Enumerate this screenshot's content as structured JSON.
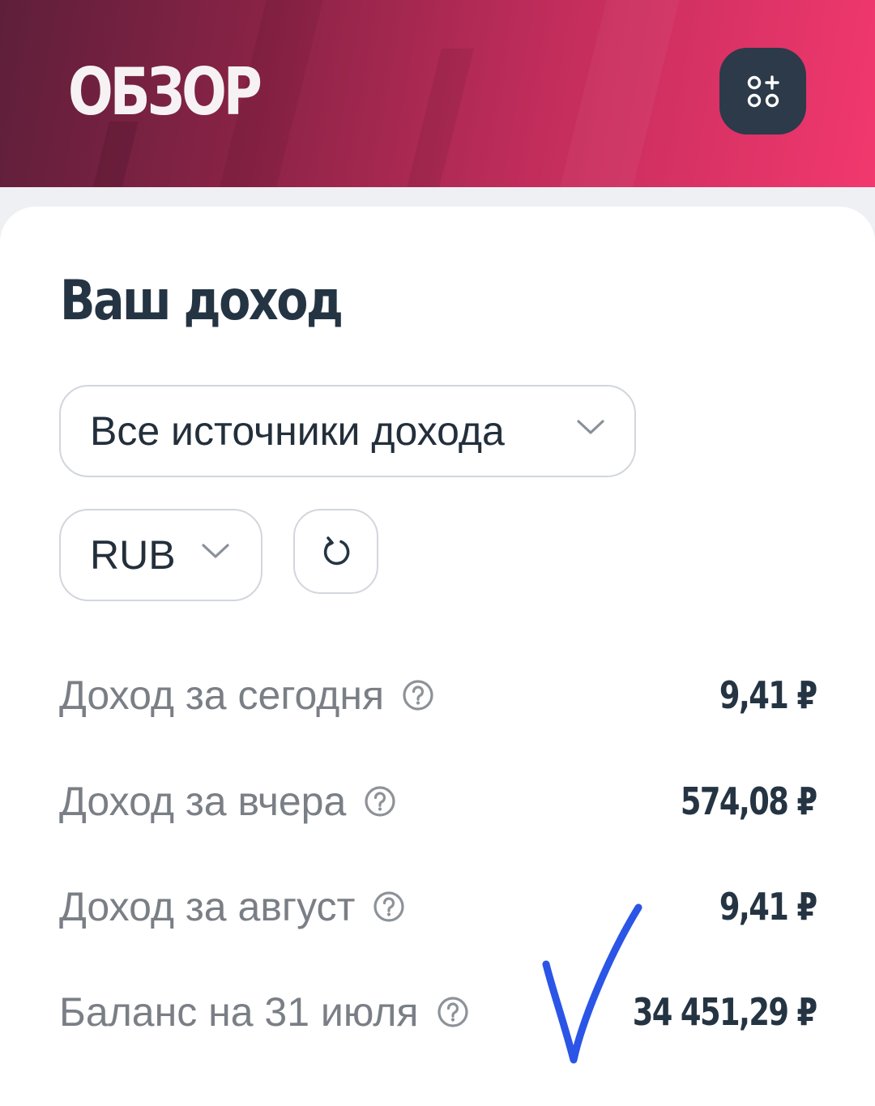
{
  "header": {
    "title": "ОБЗОР",
    "widgets_icon": "widgets-add-icon"
  },
  "income": {
    "title": "Ваш доход",
    "source_select": {
      "value": "Все источники дохода",
      "icon": "chevron-down-icon"
    },
    "currency_select": {
      "value": "RUB",
      "icon": "chevron-down-icon"
    },
    "refresh_icon": "refresh-icon",
    "rows": [
      {
        "label": "Доход за сегодня",
        "value": "9,41 ₽"
      },
      {
        "label": "Доход за вчера",
        "value": "574,08 ₽"
      },
      {
        "label": "Доход за август",
        "value": "9,41 ₽"
      },
      {
        "label": "Баланс на 31 июля",
        "value": "34 451,29 ₽"
      }
    ]
  },
  "annotation": {
    "type": "handwritten-checkmark",
    "color": "#2b55e6"
  },
  "colors": {
    "header_gradient": [
      "#5e1f3a",
      "#c22d5c",
      "#f2386e"
    ],
    "title_text": "#253443",
    "muted_text": "#7a7f86",
    "button_dark": "#2c3a4a"
  }
}
